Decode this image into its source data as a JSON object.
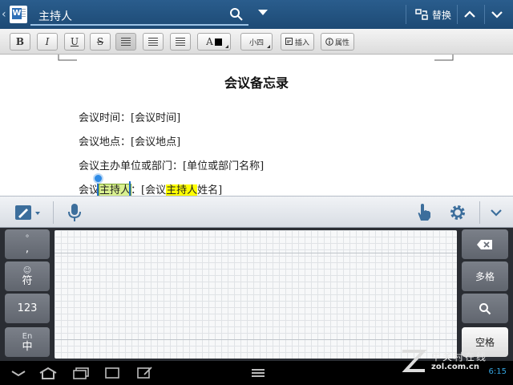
{
  "find_bar": {
    "search_value": "主持人",
    "replace_label": "替换"
  },
  "format_toolbar": {
    "bold": "B",
    "italic": "I",
    "underline": "U",
    "strike": "S",
    "font_color_label": "A",
    "font_size": "小四",
    "insert_label": "插入",
    "properties_label": "属性"
  },
  "document": {
    "title": "会议备忘录",
    "lines": [
      "会议时间：[会议时间]",
      "会议地点：[会议地点]",
      "会议主办单位或部门：[单位或部门名称]"
    ],
    "line4": {
      "prefix": "会议",
      "selected_match": "主持人",
      "middle": "：[会议",
      "match": "主持人",
      "suffix": "姓名]"
    }
  },
  "keyboard": {
    "left_keys": [
      {
        "sub": "°",
        "main": ","
      },
      {
        "sub": "☺",
        "main": "符"
      },
      {
        "sub": "",
        "main": "123"
      },
      {
        "sub": "En",
        "main": "中"
      }
    ],
    "right_keys": {
      "multi_space": "多格",
      "space": "空格"
    }
  },
  "status_bar": {
    "time": "6:15"
  },
  "watermark": {
    "line1": "中关村在线",
    "line2": "zol.com.cn"
  }
}
